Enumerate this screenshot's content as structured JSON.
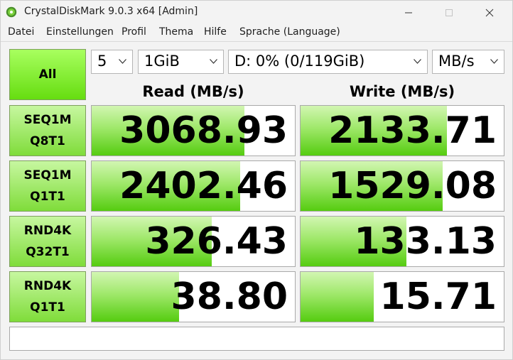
{
  "window": {
    "title": "CrystalDiskMark 9.0.3 x64 [Admin]"
  },
  "menu": {
    "items": [
      "Datei",
      "Einstellungen",
      "Profil",
      "Thema",
      "Hilfe",
      "Sprache (Language)"
    ]
  },
  "controls": {
    "all_label": "All",
    "count": "5",
    "size": "1GiB",
    "drive": "D: 0% (0/119GiB)",
    "unit": "MB/s"
  },
  "headers": {
    "read": "Read (MB/s)",
    "write": "Write (MB/s)"
  },
  "tests": [
    {
      "line1": "SEQ1M",
      "line2": "Q8T1",
      "read": "3068.93",
      "write": "2133.71",
      "read_fill": 0.75,
      "write_fill": 0.72
    },
    {
      "line1": "SEQ1M",
      "line2": "Q1T1",
      "read": "2402.46",
      "write": "1529.08",
      "read_fill": 0.73,
      "write_fill": 0.7
    },
    {
      "line1": "RND4K",
      "line2": "Q32T1",
      "read": "326.43",
      "write": "133.13",
      "read_fill": 0.59,
      "write_fill": 0.52
    },
    {
      "line1": "RND4K",
      "line2": "Q1T1",
      "read": "38.80",
      "write": "15.71",
      "read_fill": 0.43,
      "write_fill": 0.36
    }
  ],
  "comment": "",
  "colors": {
    "accent_green": "#66dd10",
    "bar_green": "#55cc10"
  }
}
